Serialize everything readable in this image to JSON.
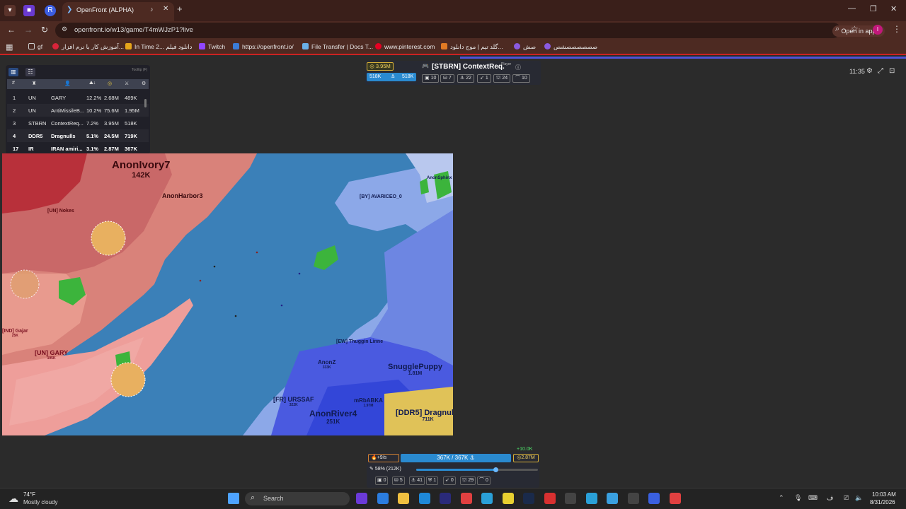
{
  "browser": {
    "tab_title": "OpenFront (ALPHA)",
    "url": "openfront.io/w13/game/T4mWJzP1?live",
    "open_in_app": "Open in app",
    "bookmarks": [
      "gf",
      "آموزش کار با نرم افزار...",
      "In Time 2... دانلود فیلم",
      "Twitch",
      "https://openfront.io/",
      "File Transfer | Docs T...",
      "www.pinterest.com",
      "گلد تیم | موج دانلود...",
      "صش",
      "صصصصصصشص"
    ]
  },
  "leaderboard": {
    "corner_label": "Tooltip (F)",
    "rows": [
      {
        "rank": "1",
        "clan": "UN",
        "name": "GARY",
        "land": "12.2%",
        "gold": "2.68M",
        "troops": "489K",
        "bold": false
      },
      {
        "rank": "2",
        "clan": "UN",
        "name": "AntiMissileB...",
        "land": "10.2%",
        "gold": "75.6M",
        "troops": "1.95M",
        "bold": false
      },
      {
        "rank": "3",
        "clan": "STBRN",
        "name": "ContextReq...",
        "land": "7.2%",
        "gold": "3.95M",
        "troops": "518K",
        "bold": false
      },
      {
        "rank": "4",
        "clan": "DDR5",
        "name": "Dragnulls",
        "land": "5.1%",
        "gold": "24.5M",
        "troops": "719K",
        "bold": true
      },
      {
        "rank": "17",
        "clan": "IR",
        "name": "IRAN amiri...",
        "land": "3.1%",
        "gold": "2.87M",
        "troops": "367K",
        "bold": true
      }
    ]
  },
  "top_info": {
    "gold": "3.95M",
    "troops_a": "518K",
    "troops_b": "518K",
    "player_name": "[STBRN] ContextReq.",
    "player_tag": "Player",
    "chips": [
      "10",
      "7",
      "22",
      "1",
      "24",
      "10"
    ]
  },
  "top_right": {
    "time": "11:35"
  },
  "map": {
    "labels": [
      {
        "text": "AnonIvory7",
        "sub": "142K"
      },
      {
        "text": "AnonHarbor3",
        "sub": ""
      },
      {
        "text": "[UN] GARY",
        "sub": "195K"
      },
      {
        "text": "[IND] Gajar",
        "sub": "25K"
      },
      {
        "text": "[BY] AVARICEO_0",
        "sub": ""
      },
      {
        "text": "AnonSphinx",
        "sub": ""
      },
      {
        "text": "[EW] Thuggin Linne",
        "sub": ""
      },
      {
        "text": "AnonZ",
        "sub": "333K"
      },
      {
        "text": "SnugglePuppy",
        "sub": "1.81M"
      },
      {
        "text": "[FR] URSSAF",
        "sub": "322K"
      },
      {
        "text": "mRbABKA",
        "sub": "1.97M"
      },
      {
        "text": "AnonRiver4",
        "sub": "251K"
      },
      {
        "text": "[DDR5] Dragnulls",
        "sub": "711K"
      },
      {
        "text": "[UN] Nokes",
        "sub": ""
      }
    ]
  },
  "bottom": {
    "income": "+9/s",
    "gain": "+10.0K",
    "troops": "367K / 367K",
    "gold": "2.87M",
    "ratio": "58% (212K)",
    "slider": 0.65,
    "chips": [
      "0",
      "5",
      "41",
      "1",
      "0",
      "29",
      "0"
    ]
  },
  "taskbar": {
    "temp": "74°F",
    "weather": "Mostly cloudy",
    "search": "Search",
    "time": "10:03 AM",
    "date": "8/31/2026"
  },
  "colors": {
    "accent": "#4f53d8",
    "map_water": "#3b80b8",
    "red_player": "#d42a3a",
    "blue_player": "#3d4ee0",
    "gold": "#d8b036"
  }
}
